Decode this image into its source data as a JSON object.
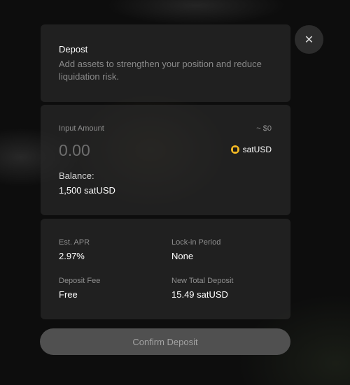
{
  "header": {
    "title": "Depost",
    "description": "Add assets to strengthen your position and reduce liquidation risk."
  },
  "input": {
    "label": "Input Amount",
    "usd_value": "~ $0",
    "placeholder": "0.00",
    "value": "",
    "token": "satUSD",
    "balance_label": "Balance:",
    "balance_value": "1,500 satUSD"
  },
  "stats": {
    "apr_label": "Est. APR",
    "apr_value": "2.97%",
    "lock_label": "Lock-in Period",
    "lock_value": "None",
    "fee_label": "Deposit Fee",
    "fee_value": "Free",
    "total_label": "New Total Deposit",
    "total_value": "15.49 satUSD"
  },
  "actions": {
    "confirm_label": "Confirm Deposit",
    "close_icon": "close-icon"
  },
  "colors": {
    "token_accent": "#f2b824",
    "card_bg": "#282828",
    "button_disabled_bg": "#505050"
  }
}
